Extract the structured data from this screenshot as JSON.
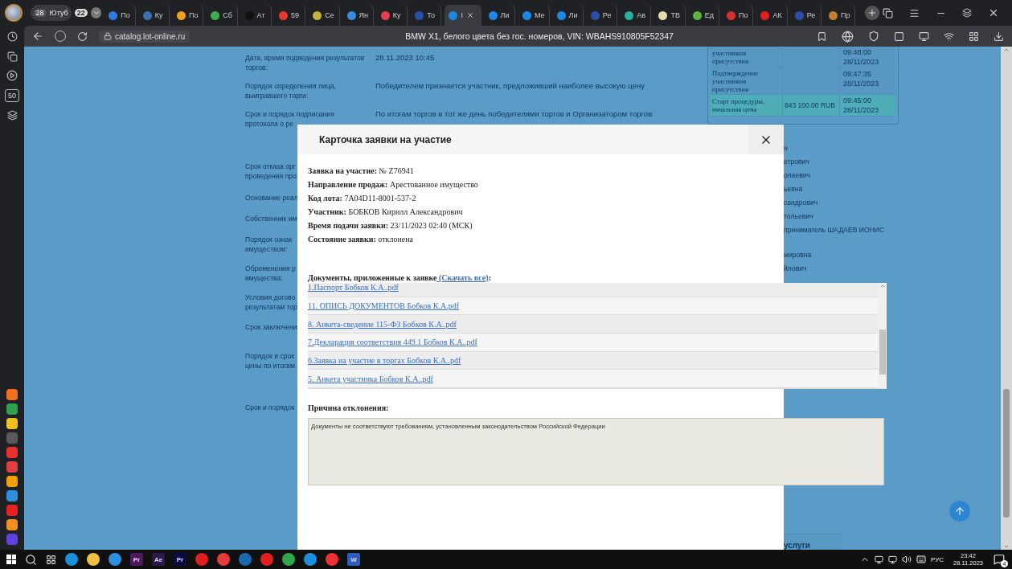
{
  "browser": {
    "tab_strip": {
      "group_count": "28",
      "group_label": "Ютуб",
      "badge": "22",
      "tabs": [
        {
          "label": "По",
          "color": "#2f7be0",
          "selected": false
        },
        {
          "label": "Ку",
          "color": "#3f6fb0",
          "selected": false
        },
        {
          "label": "По",
          "color": "#f0a020",
          "selected": false
        },
        {
          "label": "Сб",
          "color": "#3cb04a",
          "selected": false
        },
        {
          "label": "Ат",
          "color": "#111111",
          "selected": false
        },
        {
          "label": "59",
          "color": "#e8372c",
          "selected": false
        },
        {
          "label": "Се",
          "color": "#c8b040",
          "selected": false
        },
        {
          "label": "Ян",
          "color": "#3a8be0",
          "selected": false
        },
        {
          "label": "Ку",
          "color": "#e04050",
          "selected": false
        },
        {
          "label": "То",
          "color": "#2a4fa8",
          "selected": false
        },
        {
          "label": "I",
          "color": "#1e88e5",
          "selected": true
        },
        {
          "label": "Ли",
          "color": "#1e88e5",
          "selected": false
        },
        {
          "label": "Ме",
          "color": "#1e88e5",
          "selected": false
        },
        {
          "label": "Ли",
          "color": "#1e88e5",
          "selected": false
        },
        {
          "label": "Ре",
          "color": "#2a4fa8",
          "selected": false
        },
        {
          "label": "Ав",
          "color": "#2ab0a0",
          "selected": false
        },
        {
          "label": "ТВ",
          "color": "#e8d8b0",
          "selected": false
        },
        {
          "label": "Ед",
          "color": "#60b040",
          "selected": false
        },
        {
          "label": "По",
          "color": "#d83030",
          "selected": false
        },
        {
          "label": "АК",
          "color": "#e02020",
          "selected": false
        },
        {
          "label": "Ре",
          "color": "#2a4fa8",
          "selected": false
        },
        {
          "label": "Пр",
          "color": "#c08030",
          "selected": false
        }
      ]
    },
    "address": {
      "url": "catalog.lot-online.ru",
      "title": "BMW X1, белого цвета без гос. номеров, VIN: WBAHS910805F52347"
    },
    "sidebar": {
      "badge": "50",
      "apps": [
        {
          "color": "#f07020"
        },
        {
          "color": "#30a050"
        },
        {
          "color": "#f0c020"
        },
        {
          "color": "#5a5a5a"
        },
        {
          "color": "#e83030"
        },
        {
          "color": "#e04040"
        },
        {
          "color": "#f0a000"
        },
        {
          "color": "#3090e0"
        },
        {
          "color": "#e82020"
        },
        {
          "color": "#f09020"
        },
        {
          "color": "#6040e0"
        }
      ]
    }
  },
  "page": {
    "rows": [
      {
        "label": "Дата, время подведения результатов торгов:",
        "value": "28.11.2023 10:45"
      },
      {
        "label": "Порядок определения лица, выигравшего торги:",
        "value": "Победителем признается участник, предложивший наиболее высокую цену"
      },
      {
        "label": "Срок и порядок подписания\nпротокола о ре",
        "value": "По итогам торгов в тот же день победителями торгов и Организатором торгов"
      }
    ],
    "covered_labels": [
      "Срок отказа орг\nпроведения про",
      "Основание реал",
      "Собственник им",
      "Порядок ознак\nимуществом:",
      "Обременения р\nимущества:",
      "Условия догово\nрезультатам тор",
      "Срок заключени",
      "Порядок и срок\nцены по итогам",
      "Срок и порядок"
    ],
    "names": [
      "н",
      "етрович",
      "олаевич",
      "ьевна",
      "сандрович",
      "тольевич",
      "приниматель ШАДАЕВ ИОНИС",
      "мировна",
      "йлович"
    ],
    "events_table": {
      "rows": [
        {
          "event": "участником\nприсутствия",
          "price": "",
          "time": "09:48:00",
          "date": "28/11/2023",
          "highlighted": false
        },
        {
          "event": "Подтверждение\nучастником\nприсутствия",
          "price": "",
          "time": "09:47:35",
          "date": "28/11/2023",
          "highlighted": false
        },
        {
          "event": "Старт процедуры,\nначальная цена",
          "price": "843 100.00 RUB",
          "time": "09:45:00",
          "date": "28/11/2023",
          "highlighted": true
        }
      ]
    },
    "footer_heading": "услуги"
  },
  "modal": {
    "title": "Карточка заявки на участие",
    "fields": [
      {
        "label": "Заявка на участие:",
        "value": "№ Z76941"
      },
      {
        "label": "Направление продаж:",
        "value": "Арестованное имущество"
      },
      {
        "label": "Код лота:",
        "value": "7A04D11-8001-537-2"
      },
      {
        "label": "Участник:",
        "value": "БОБКОВ Кирилл Александрович"
      },
      {
        "label": "Время подачи заявки:",
        "value": "23/11/2023 02:40 (МСК)"
      },
      {
        "label": "Состояние заявки:",
        "value": "отклонена"
      }
    ],
    "documents_heading": "Документы, приложенные к заявке",
    "download_all": "(Скачать все)",
    "documents_suffix": ":",
    "documents": [
      "1.Паспорт Бобков К.А..pdf",
      "11. ОПИСЬ ДОКУМЕНТОВ Бобков К.А.pdf",
      "8. Анкета-сведение 115-ФЗ Бобков К.А..pdf",
      "7.Декларация соответствия 449.1 Бобков К.А..pdf",
      "6.Заявка на участие в торгах Бобков К.А..pdf",
      "5. Анкета участника Бобков К.А..pdf"
    ],
    "reason_label": "Причина отклонения:",
    "reason": "Документы не соответствуют требованиям, установленным законодательством Российской Федерации"
  },
  "taskbar": {
    "apps": [
      {
        "kind": "icon",
        "color": "#1c8fd8"
      },
      {
        "kind": "icon",
        "color": "#f0c040"
      },
      {
        "kind": "icon",
        "color": "#2d8fe0"
      },
      {
        "kind": "tile",
        "color": "#4a1a5a",
        "label": "Pr"
      },
      {
        "kind": "tile",
        "color": "#2a1a4a",
        "label": "Ae"
      },
      {
        "kind": "tile",
        "color": "#0a0a40",
        "label": "Pr"
      },
      {
        "kind": "icon",
        "color": "#e02020"
      },
      {
        "kind": "icon",
        "color": "#e83a3a"
      },
      {
        "kind": "icon",
        "color": "#1a6ab0"
      },
      {
        "kind": "icon",
        "color": "#e02020"
      },
      {
        "kind": "icon",
        "color": "#2fa84f"
      },
      {
        "kind": "icon",
        "color": "#1e90e0"
      },
      {
        "kind": "icon",
        "color": "#f03030"
      },
      {
        "kind": "tile",
        "color": "#2b5eb8",
        "label": "W"
      }
    ],
    "language": "РУС",
    "time": "23:42",
    "date": "28.11.2023",
    "notifications": "4"
  }
}
